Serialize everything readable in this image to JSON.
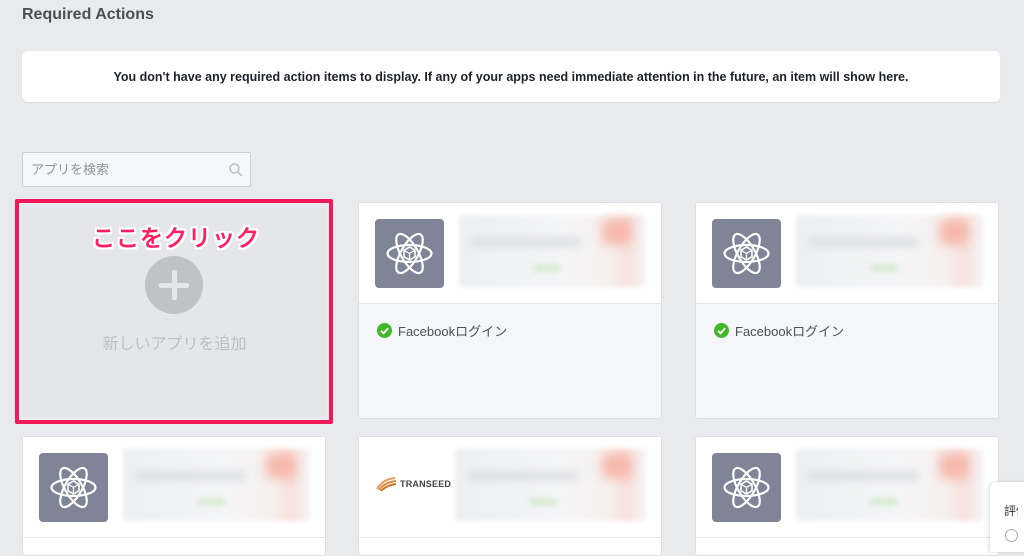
{
  "page": {
    "title": "Required Actions",
    "notice": "You don't have any required action items to display. If any of your apps need immediate attention in the future, an item will show here."
  },
  "search": {
    "placeholder": "アプリを検索",
    "icon": "search-icon"
  },
  "add_app": {
    "annotation": "ここをクリック",
    "label": "新しいアプリを追加",
    "highlight_color": "#f0195a"
  },
  "apps": [
    {
      "status": "Facebookログイン",
      "icon": "atom-icon"
    },
    {
      "status": "Facebookログイン",
      "icon": "atom-icon"
    },
    {
      "status": "",
      "icon": "atom-icon"
    },
    {
      "status": "",
      "icon": "transeed-logo",
      "logo_text": "TRANSEED"
    },
    {
      "status": "",
      "icon": "atom-icon"
    }
  ],
  "side_panel": {
    "label": "評価"
  },
  "colors": {
    "background": "#e9eaed",
    "app_icon_bg": "#7f8596",
    "success_green": "#42b72a"
  }
}
